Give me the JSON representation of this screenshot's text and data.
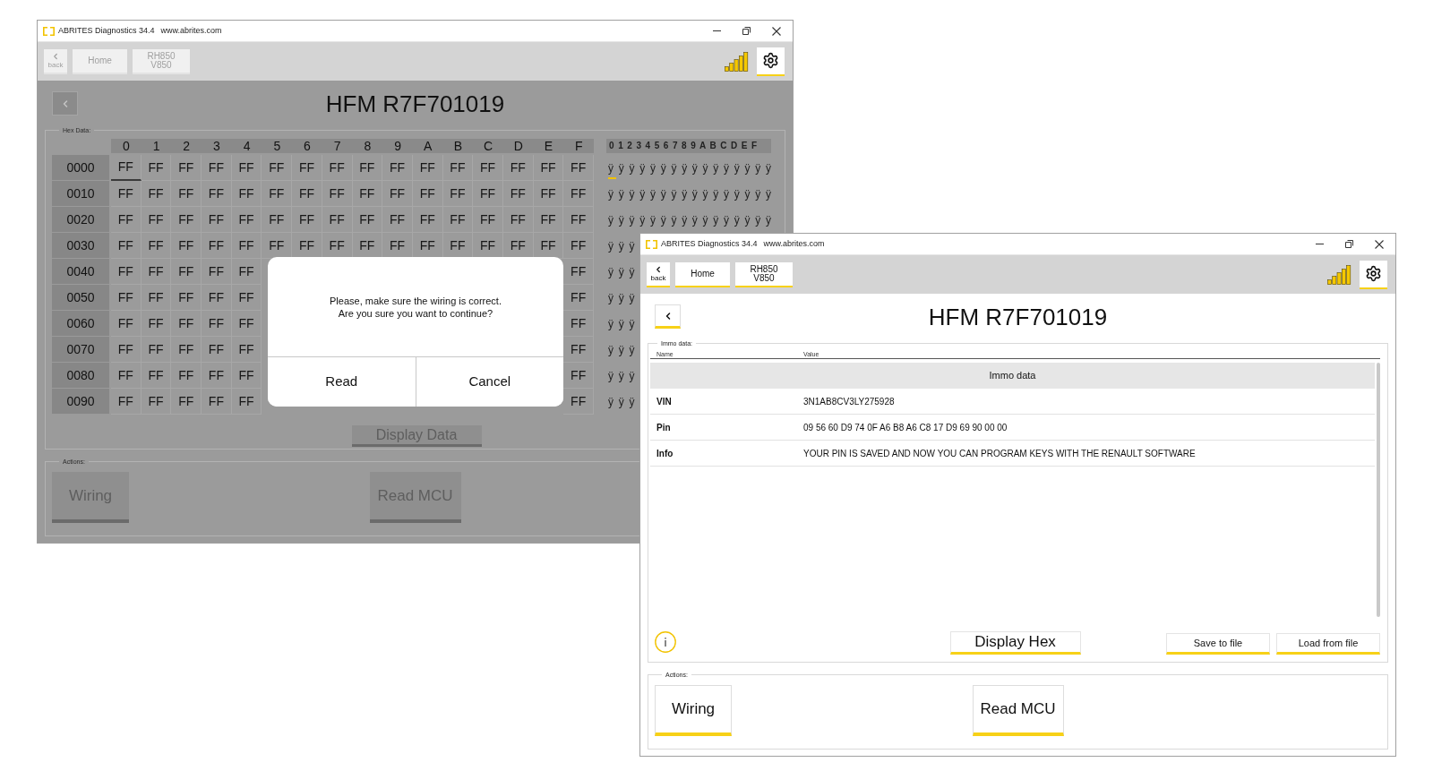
{
  "windows": [
    {
      "kind": "hex",
      "title_bar": {
        "app": "ABRITES Diagnostics 34.4",
        "url": "www.abrites.com"
      },
      "toolbar": {
        "back": {
          "label": "back",
          "disabled": true
        },
        "buttons": [
          {
            "lines": [
              "Home"
            ],
            "disabled": true
          },
          {
            "lines": [
              "RH850",
              "V850"
            ],
            "disabled": true
          }
        ]
      },
      "page_title": "HFM R7F701019",
      "hex_data": {
        "legend": "Hex Data:",
        "columns": [
          "0",
          "1",
          "2",
          "3",
          "4",
          "5",
          "6",
          "7",
          "8",
          "9",
          "A",
          "B",
          "C",
          "D",
          "E",
          "F"
        ],
        "ascii_header": "0 1 2 3 4 5 6 7 8 9 A B C D E F",
        "rows": [
          {
            "address": "0000",
            "selected": true,
            "cells": [
              "FF",
              "FF",
              "FF",
              "FF",
              "FF",
              "FF",
              "FF",
              "FF",
              "FF",
              "FF",
              "FF",
              "FF",
              "FF",
              "FF",
              "FF",
              "FF"
            ],
            "ascii": "ÿ ÿ ÿ ÿ ÿ ÿ ÿ ÿ ÿ ÿ ÿ ÿ ÿ ÿ ÿ ÿ"
          },
          {
            "address": "0010",
            "selected": false,
            "cells": [
              "FF",
              "FF",
              "FF",
              "FF",
              "FF",
              "FF",
              "FF",
              "FF",
              "FF",
              "FF",
              "FF",
              "FF",
              "FF",
              "FF",
              "FF",
              "FF"
            ],
            "ascii": "ÿ ÿ ÿ ÿ ÿ ÿ ÿ ÿ ÿ ÿ ÿ ÿ ÿ ÿ ÿ ÿ"
          },
          {
            "address": "0020",
            "selected": false,
            "cells": [
              "FF",
              "FF",
              "FF",
              "FF",
              "FF",
              "FF",
              "FF",
              "FF",
              "FF",
              "FF",
              "FF",
              "FF",
              "FF",
              "FF",
              "FF",
              "FF"
            ],
            "ascii": "ÿ ÿ ÿ ÿ ÿ ÿ ÿ ÿ ÿ ÿ ÿ ÿ ÿ ÿ ÿ ÿ"
          },
          {
            "address": "0030",
            "selected": false,
            "cells": [
              "FF",
              "FF",
              "FF",
              "FF",
              "FF",
              "FF",
              "FF",
              "FF",
              "FF",
              "FF",
              "FF",
              "FF",
              "FF",
              "FF",
              "FF",
              "FF"
            ],
            "ascii": "ÿ ÿ ÿ"
          },
          {
            "address": "0040",
            "selected": false,
            "cells": [
              "FF",
              "FF",
              "FF",
              "FF",
              "FF",
              null,
              null,
              null,
              null,
              null,
              null,
              null,
              null,
              null,
              null,
              "FF"
            ],
            "ascii": "ÿ ÿ ÿ"
          },
          {
            "address": "0050",
            "selected": false,
            "cells": [
              "FF",
              "FF",
              "FF",
              "FF",
              "FF",
              null,
              null,
              null,
              null,
              null,
              null,
              null,
              null,
              null,
              null,
              "FF"
            ],
            "ascii": "ÿ ÿ ÿ"
          },
          {
            "address": "0060",
            "selected": false,
            "cells": [
              "FF",
              "FF",
              "FF",
              "FF",
              "FF",
              null,
              null,
              null,
              null,
              null,
              null,
              null,
              null,
              null,
              null,
              "FF"
            ],
            "ascii": "ÿ ÿ ÿ"
          },
          {
            "address": "0070",
            "selected": false,
            "cells": [
              "FF",
              "FF",
              "FF",
              "FF",
              "FF",
              null,
              null,
              null,
              null,
              null,
              null,
              null,
              null,
              null,
              null,
              "FF"
            ],
            "ascii": "ÿ ÿ ÿ"
          },
          {
            "address": "0080",
            "selected": false,
            "cells": [
              "FF",
              "FF",
              "FF",
              "FF",
              "FF",
              null,
              null,
              null,
              null,
              null,
              null,
              null,
              null,
              null,
              null,
              "FF"
            ],
            "ascii": "ÿ ÿ ÿ"
          },
          {
            "address": "0090",
            "selected": false,
            "cells": [
              "FF",
              "FF",
              "FF",
              "FF",
              "FF",
              null,
              null,
              null,
              null,
              null,
              null,
              null,
              null,
              null,
              null,
              "FF"
            ],
            "ascii": "ÿ ÿ ÿ"
          }
        ]
      },
      "display_button": "Display Data",
      "actions": {
        "legend": "Actions:",
        "buttons": [
          "Wiring",
          "Read MCU"
        ]
      },
      "dialog": {
        "message": [
          "Please, make sure the wiring is correct.",
          "Are you sure you want to continue?"
        ],
        "buttons": [
          "Read",
          "Cancel"
        ]
      }
    },
    {
      "kind": "immo",
      "title_bar": {
        "app": "ABRITES Diagnostics 34.4",
        "url": "www.abrites.com"
      },
      "toolbar": {
        "back": {
          "label": "back",
          "disabled": false
        },
        "buttons": [
          {
            "lines": [
              "Home"
            ],
            "disabled": false
          },
          {
            "lines": [
              "RH850",
              "V850"
            ],
            "disabled": false
          }
        ]
      },
      "page_title": "HFM R7F701019",
      "immo_data": {
        "legend": "Immo data:",
        "columns": [
          "Name",
          "Value"
        ],
        "group": "Immo data",
        "rows": [
          {
            "name": "VIN",
            "value": "3N1AB8CV3LY275928"
          },
          {
            "name": "Pin",
            "value": "09 56 60 D9 74 0F A6 B8 A6 C8 17 D9 69 90 00 00"
          },
          {
            "name": "Info",
            "value": "YOUR PIN IS SAVED AND NOW YOU CAN PROGRAM KEYS WITH THE RENAULT SOFTWARE"
          }
        ]
      },
      "display_button": "Display Hex",
      "file_buttons": [
        "Save to file",
        "Load from file"
      ],
      "actions": {
        "legend": "Actions:",
        "buttons": [
          "Wiring",
          "Read MCU"
        ]
      }
    }
  ]
}
